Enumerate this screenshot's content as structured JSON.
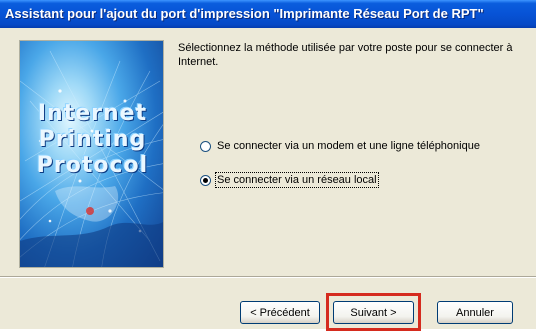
{
  "window": {
    "title": "Assistant pour l'ajout du port d'impression \"Imprimante Réseau Port de RPT\""
  },
  "banner": {
    "line1": "Internet",
    "line2": "Printing",
    "line3": "Protocol"
  },
  "instruction": "Sélectionnez la méthode utilisée par votre poste pour se connecter à Internet.",
  "options": [
    {
      "label": "Se connecter via un modem et une ligne téléphonique",
      "selected": false
    },
    {
      "label": "Se connecter via un réseau local",
      "selected": true
    }
  ],
  "buttons": {
    "back": "< Précédent",
    "next": "Suivant >",
    "cancel": "Annuler"
  },
  "colors": {
    "title_bar": "#0753d6",
    "dialog_bg": "#ece9d8",
    "highlight": "#d52b1e"
  }
}
